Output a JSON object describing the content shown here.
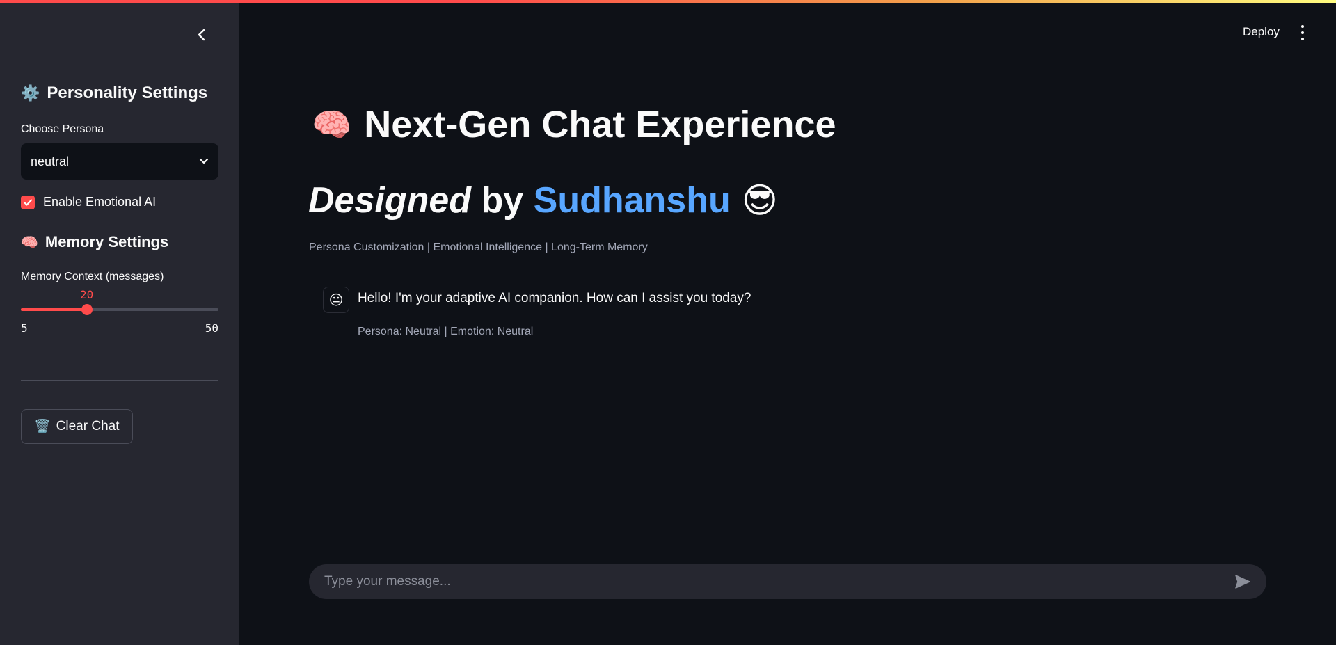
{
  "sidebar": {
    "collapse_icon": "chevron-left-icon",
    "personality_settings": {
      "icon": "⚙️",
      "title": "Personality Settings",
      "persona_label": "Choose Persona",
      "persona_value": "neutral",
      "emotional_ai_label": "Enable Emotional AI",
      "emotional_ai_checked": true
    },
    "memory_settings": {
      "icon": "🧠",
      "title": "Memory Settings",
      "slider_label": "Memory Context (messages)",
      "slider_value": "20",
      "slider_min": "5",
      "slider_max": "50"
    },
    "clear_chat": {
      "icon": "🗑️",
      "label": "Clear Chat"
    }
  },
  "header": {
    "deploy_label": "Deploy",
    "menu_icon": "vertical-dots-icon"
  },
  "main": {
    "title_icon": "🧠",
    "title": "Next-Gen Chat Experience",
    "designed_italic": "Designed",
    "designed_by": " by ",
    "designed_name": "Sudhanshu",
    "designed_emoji": "😎",
    "caption": "Persona Customization | Emotional Intelligence | Long-Term Memory",
    "messages": [
      {
        "avatar": "😐",
        "text": "Hello! I'm your adaptive AI companion. How can I assist you today?",
        "caption": "Persona: Neutral | Emotion: Neutral"
      }
    ],
    "input_placeholder": "Type your message..."
  },
  "colors": {
    "accent": "#ff4b4b",
    "link_blue": "#58a6ff",
    "background": "#0e1117",
    "sidebar_bg": "#262730"
  }
}
